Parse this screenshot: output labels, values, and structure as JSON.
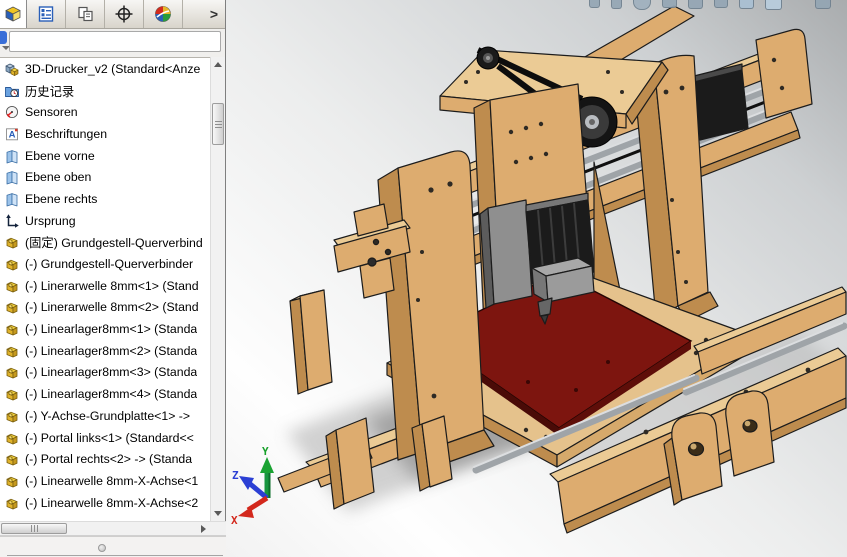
{
  "feature_manager": {
    "tabs": [
      {
        "icon": "feature-tree-icon",
        "active": true
      },
      {
        "icon": "property-manager-icon",
        "active": false
      },
      {
        "icon": "configuration-manager-icon",
        "active": false
      },
      {
        "icon": "dimxpert-icon",
        "active": false
      },
      {
        "icon": "display-manager-icon",
        "active": false
      }
    ],
    "overflow_arrow": ">",
    "filter_value": "",
    "items": [
      {
        "icon": "assembly-icon",
        "label": "3D-Drucker_v2 (Standard<Anze"
      },
      {
        "icon": "history-folder-icon",
        "label": "历史记录"
      },
      {
        "icon": "sensors-icon",
        "label": "Sensoren"
      },
      {
        "icon": "annotations-icon",
        "label": "Beschriftungen"
      },
      {
        "icon": "plane-icon",
        "label": "Ebene vorne"
      },
      {
        "icon": "plane-icon",
        "label": "Ebene oben"
      },
      {
        "icon": "plane-icon",
        "label": "Ebene rechts"
      },
      {
        "icon": "origin-icon",
        "label": "Ursprung"
      },
      {
        "icon": "part-icon",
        "label": "(固定) Grundgestell-Querverbind"
      },
      {
        "icon": "part-icon",
        "label": "(-) Grundgestell-Querverbinder"
      },
      {
        "icon": "part-icon",
        "label": "(-) Linerarwelle 8mm<1> (Stand"
      },
      {
        "icon": "part-icon",
        "label": "(-) Linerarwelle 8mm<2> (Stand"
      },
      {
        "icon": "part-icon",
        "label": "(-) Linearlager8mm<1> (Standa"
      },
      {
        "icon": "part-icon",
        "label": "(-) Linearlager8mm<2> (Standa"
      },
      {
        "icon": "part-icon",
        "label": "(-) Linearlager8mm<3> (Standa"
      },
      {
        "icon": "part-icon",
        "label": "(-) Linearlager8mm<4> (Standa"
      },
      {
        "icon": "part-icon",
        "label": "(-) Y-Achse-Grundplatte<1> ->"
      },
      {
        "icon": "part-icon",
        "label": "(-) Portal links<1> (Standard<<"
      },
      {
        "icon": "part-icon",
        "label": "(-) Portal rechts<2> -> (Standa"
      },
      {
        "icon": "part-icon",
        "label": "(-) Linearwelle 8mm-X-Achse<1"
      },
      {
        "icon": "part-icon",
        "label": "(-) Linearwelle 8mm-X-Achse<2"
      }
    ]
  },
  "viewport": {
    "triad": {
      "x_label": "X",
      "y_label": "Y",
      "z_label": "Z"
    },
    "colors": {
      "wood_front": "#DDAC6F",
      "wood_side": "#BE8C4E",
      "wood_top": "#EBCB95",
      "platform_top": "#E5C28C",
      "print_bed_red": "#7D150F",
      "chrome": "#9FA4A8",
      "machine_black": "#1B1B1B",
      "triad_x": "#D62F1E",
      "triad_y": "#189E2A",
      "triad_z": "#2438D8"
    }
  }
}
